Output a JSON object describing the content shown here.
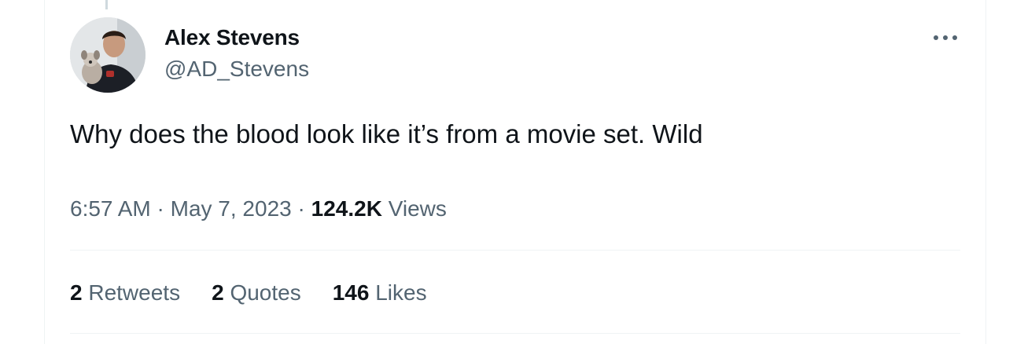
{
  "tweet": {
    "author": {
      "display_name": "Alex Stevens",
      "handle": "@AD_Stevens"
    },
    "text": "Why does the blood look like it’s from a movie set. Wild",
    "time": "6:57 AM",
    "separator": "·",
    "date": "May 7, 2023",
    "views_count": "124.2K",
    "views_label": "Views",
    "stats": {
      "retweets_count": "2",
      "retweets_label": "Retweets",
      "quotes_count": "2",
      "quotes_label": "Quotes",
      "likes_count": "146",
      "likes_label": "Likes"
    },
    "icons": {
      "more": "more-horizontal-icon"
    }
  }
}
